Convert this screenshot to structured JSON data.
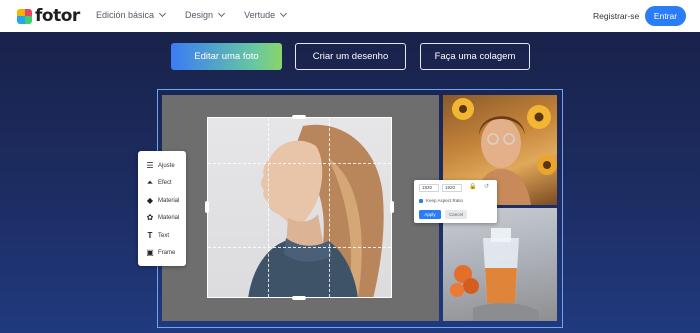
{
  "header": {
    "logo_text": "fotor",
    "nav": [
      {
        "label": "Edición básica"
      },
      {
        "label": "Design"
      },
      {
        "label": "Vertude"
      }
    ],
    "register_label": "Registrar-se",
    "login_label": "Entrar"
  },
  "actions": {
    "edit_photo": "Editar uma foto",
    "create_design": "Criar um desenho",
    "make_collage": "Faça uma colagem"
  },
  "tools": [
    {
      "label": "Ajuste",
      "icon": "sliders-icon"
    },
    {
      "label": "Efect",
      "icon": "flask-icon"
    },
    {
      "label": "Material",
      "icon": "layers-icon"
    },
    {
      "label": "Material",
      "icon": "flower-icon"
    },
    {
      "label": "Text",
      "icon": "text-icon"
    },
    {
      "label": "Frame",
      "icon": "frame-icon"
    }
  ],
  "resize_dialog": {
    "width_value": "1920",
    "height_value": "1920",
    "keep_ratio_label": "Keep Aspect Ratio",
    "apply_label": "Apply",
    "cancel_label": "Cancel"
  },
  "colors": {
    "accent": "#2a7cf7",
    "background": "#1d2d63",
    "frame_border": "#6fa3f4"
  }
}
